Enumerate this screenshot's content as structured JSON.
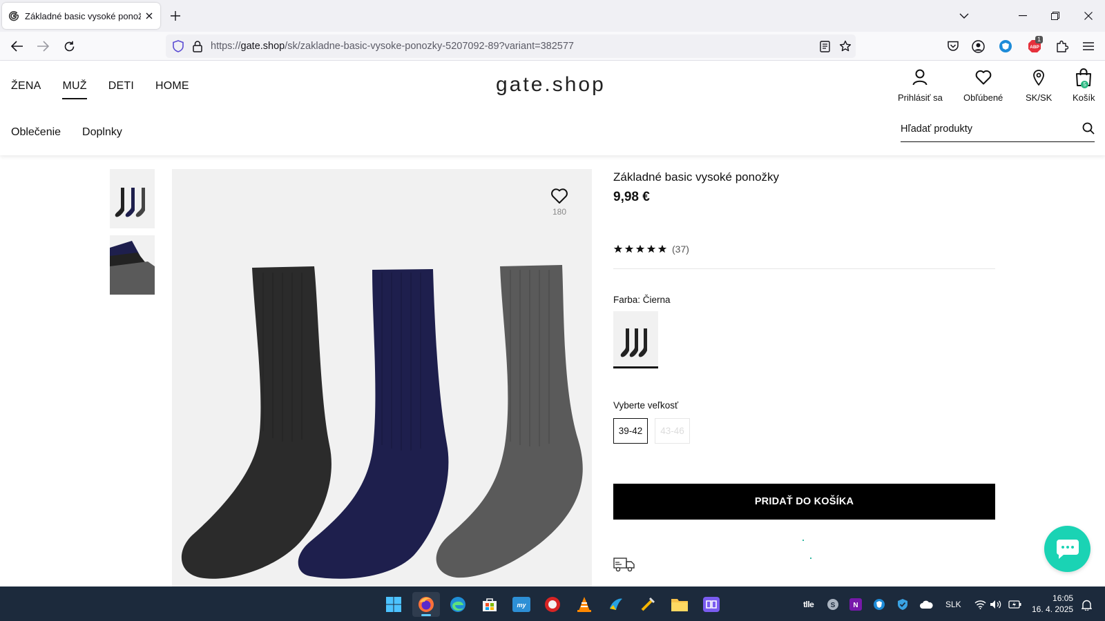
{
  "browser": {
    "tab_title": "Základné basic vysoké ponožky",
    "url_prefix": "https://",
    "url_host": "gate.shop",
    "url_path": "/sk/zakladne-basic-vysoke-ponozky-5207092-89?variant=382577",
    "badge_count": "1"
  },
  "header": {
    "nav": [
      "ŽENA",
      "MUŽ",
      "DETI",
      "HOME"
    ],
    "active_nav": "MUŽ",
    "logo": "gate.shop",
    "actions": {
      "login": "Prihlásiť sa",
      "favorites": "Obľúbené",
      "region": "SK/SK",
      "cart": "Košík"
    },
    "cart_count": "5",
    "categories": [
      "Oblečenie",
      "Doplnky"
    ],
    "search_placeholder": "Hľadať produkty"
  },
  "product": {
    "title": "Základné basic vysoké ponožky",
    "price": "9,98 €",
    "rating_stars": 5,
    "review_count": "(37)",
    "favorite_count": "180",
    "color_label": "Farba: Čierna",
    "size_label": "Vyberte veľkosť",
    "sizes": [
      {
        "label": "39-42",
        "available": true
      },
      {
        "label": "43-46",
        "available": false
      }
    ],
    "add_to_cart": "PRIDAŤ DO KOŠÍKA"
  },
  "taskbar": {
    "tray_text": "tlle",
    "language": "SLK",
    "time": "16:05",
    "date": "16. 4. 2025"
  },
  "colors": {
    "sock_black": "#2b2b2b",
    "sock_navy": "#1e1f4d",
    "sock_grey": "#5a5a5a",
    "chat_accent": "#1ad3b4",
    "taskbar_bg": "#1c2a3c"
  }
}
